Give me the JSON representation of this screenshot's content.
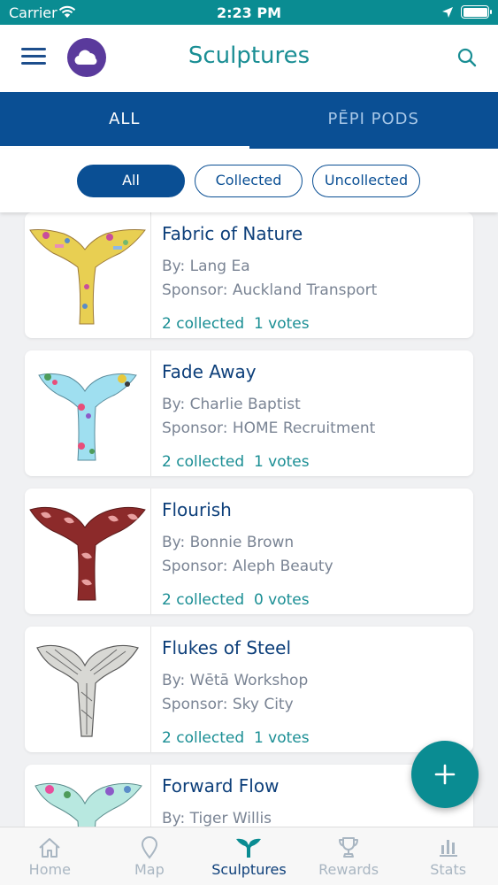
{
  "status_bar": {
    "carrier": "Carrier",
    "time": "2:23 PM",
    "battery_level": 1.0
  },
  "header": {
    "title": "Sculptures",
    "menu_icon": "hamburger-icon",
    "logo_icon": "cloud-logo-icon",
    "search_icon": "search-icon"
  },
  "tabs": [
    {
      "label": "ALL",
      "active": true
    },
    {
      "label": "PĒPI PODS",
      "active": false
    }
  ],
  "filters": [
    {
      "label": "All",
      "active": true
    },
    {
      "label": "Collected",
      "active": false
    },
    {
      "label": "Uncollected",
      "active": false
    }
  ],
  "sculptures": [
    {
      "name": "Fabric of Nature",
      "by": "By: Lang Ea",
      "sponsor": "Sponsor: Auckland Transport",
      "stats": "2 collected  1 votes"
    },
    {
      "name": "Fade Away",
      "by": "By: Charlie Baptist",
      "sponsor": "Sponsor: HOME Recruitment",
      "stats": "2 collected  1 votes"
    },
    {
      "name": "Flourish",
      "by": "By: Bonnie Brown",
      "sponsor": "Sponsor: Aleph Beauty",
      "stats": "2 collected  0 votes"
    },
    {
      "name": "Flukes of Steel",
      "by": "By: Wētā Workshop",
      "sponsor": "Sponsor: Sky City",
      "stats": "2 collected  1 votes"
    },
    {
      "name": "Forward Flow",
      "by": "By: Tiger Willis",
      "sponsor": "",
      "stats": ""
    }
  ],
  "fab": {
    "icon": "plus-icon"
  },
  "bottom_nav": [
    {
      "label": "Home",
      "icon": "home-icon",
      "active": false
    },
    {
      "label": "Map",
      "icon": "map-pin-icon",
      "active": false
    },
    {
      "label": "Sculptures",
      "icon": "whale-tail-icon",
      "active": true
    },
    {
      "label": "Rewards",
      "icon": "trophy-icon",
      "active": false
    },
    {
      "label": "Stats",
      "icon": "bar-chart-icon",
      "active": false
    }
  ],
  "colors": {
    "teal": "#0a8c92",
    "navy": "#0a4f94",
    "dark_text": "#0d3f7a",
    "muted_text": "#7a8494",
    "logo_purple": "#5a3a9c"
  }
}
